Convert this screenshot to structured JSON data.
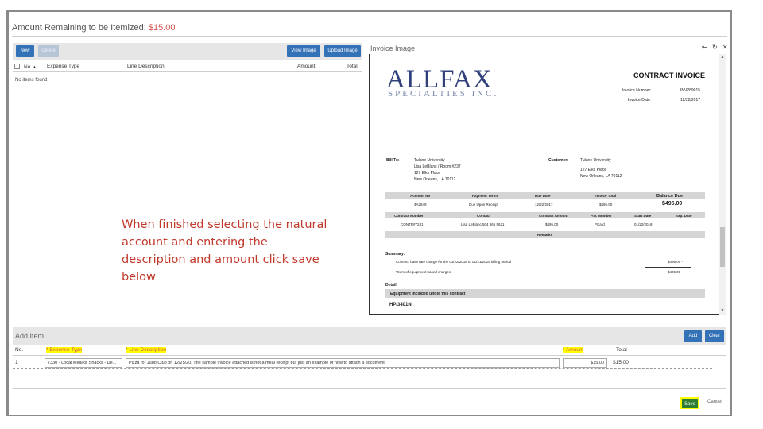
{
  "header": {
    "remaining_label": "Amount Remaining to be Itemized:",
    "remaining_amount": "$15.00"
  },
  "left": {
    "buttons": {
      "new": "New",
      "delete": "Delete",
      "view_image": "View Image",
      "upload_image": "Upload Image"
    },
    "columns": {
      "no": "No. ▴",
      "expense_type": "Expense Type",
      "line_description": "Line Description",
      "amount": "Amount",
      "total": "Total"
    },
    "empty_text": "No items found."
  },
  "instruction": "When finished selecting the natural account and entering the description and amount click save below",
  "invoice": {
    "title": "Invoice Image",
    "icons": "⇤ ↻ ✕",
    "logo_main": "ALLFAX",
    "logo_sub": "SPECIALTIES INC.",
    "doc_title": "CONTRACT INVOICE",
    "invoice_number_label": "Invoice Number:",
    "invoice_number": "INV289015",
    "invoice_date_label": "Invoice Date:",
    "invoice_date": "12/22/2017",
    "bill_to_label": "Bill To:",
    "bill_to": [
      "Tulane University",
      "Lisa LeBlanc / Room #237",
      "127 Elks Place",
      "New Orleans, LA 70112"
    ],
    "customer_label": "Customer:",
    "customer": [
      "Tulane University",
      "127 Elks Place",
      "New Orleans, LA 70112"
    ],
    "t1_headers": [
      "Account No",
      "Payment Terms",
      "Due Date",
      "Invoice Total",
      "Balance Due"
    ],
    "t1_values": [
      "4A2849",
      "Due Upon Receipt",
      "12/22/2017",
      "$495.00",
      "$495.00"
    ],
    "t2_headers": [
      "Contract Number",
      "Contact",
      "Contract Amount",
      "P.O. Number",
      "Start Date",
      "Exp. Date"
    ],
    "t2_values": [
      "CONTR#7241",
      "Lisa LeBlanc 504 865 5621",
      "$495.00",
      "PCard",
      "01/22/2018",
      ""
    ],
    "remarks_label": "Remarks",
    "summary_label": "Summary:",
    "summary_line1": "Contract base rate charge for the 01/22/2018 to 01/21/2019 billing period",
    "summary_amt1": "$495.00 *",
    "summary_line2": "*Sum of equipment based charges",
    "summary_amt2": "$495.00",
    "detail_label": "Detail:",
    "equipment_label": "Equipment included under this contract",
    "model": "HP/3401N"
  },
  "add_item": {
    "title": "Add Item",
    "add_button": "Add",
    "clear_button": "Clear",
    "columns": {
      "no": "No.",
      "expense_type": "* Expense Type",
      "line_description": "* Line Description",
      "amount": "* Amount",
      "total": "Total"
    },
    "row": {
      "no": "1",
      "expense_type": "7330 - Local Meal or Snacks - De...",
      "line_description": "Pizza for Judo Club on 12/25/20. The sample invoice attached is not a meal receipt but just an example of how to attach a document",
      "amount": "$15.00",
      "total": "$15.00"
    },
    "save_button": "Save",
    "cancel_button": "Cancel"
  }
}
